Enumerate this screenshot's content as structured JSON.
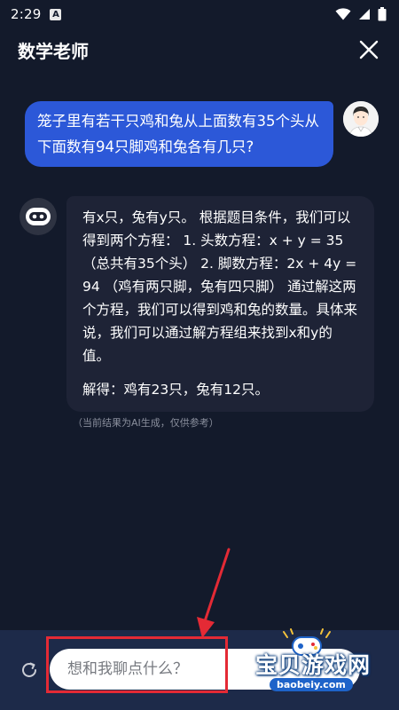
{
  "status_bar": {
    "time": "2:29",
    "notification_glyph": "A",
    "icons": [
      "wifi-icon",
      "signal-icon",
      "battery-icon"
    ]
  },
  "header": {
    "title": "数学老师",
    "close_icon": "close-icon"
  },
  "conversation": {
    "user_message": "笼子里有若干只鸡和兔从上面数有35个头从下面数有94只脚鸡和兔各有几只?",
    "bot_paragraph_1": "有x只，兔有y只。 根据题目条件，我们可以得到两个方程： 1. 头数方程：x + y = 35 （总共有35个头） 2. 脚数方程：2x + 4y = 94 （鸡有两只脚，兔有四只脚） 通过解这两个方程，我们可以得到鸡和兔的数量。具体来说，我们可以通过解方程组来找到x和y的值。",
    "bot_paragraph_2": "解得：鸡有23只，兔有12只。",
    "disclaimer": "（当前结果为AI生成，仅供参考）"
  },
  "input": {
    "placeholder": "想和我聊点什么？",
    "value": ""
  },
  "watermark": {
    "text": "宝贝游戏网",
    "url": "baobeiy.com"
  },
  "colors": {
    "background": "#131a2b",
    "user_bubble": "#2c58d8",
    "bot_bubble": "#1e2336",
    "bottom_bar": "#1d2a49",
    "highlight": "#e42a35"
  }
}
